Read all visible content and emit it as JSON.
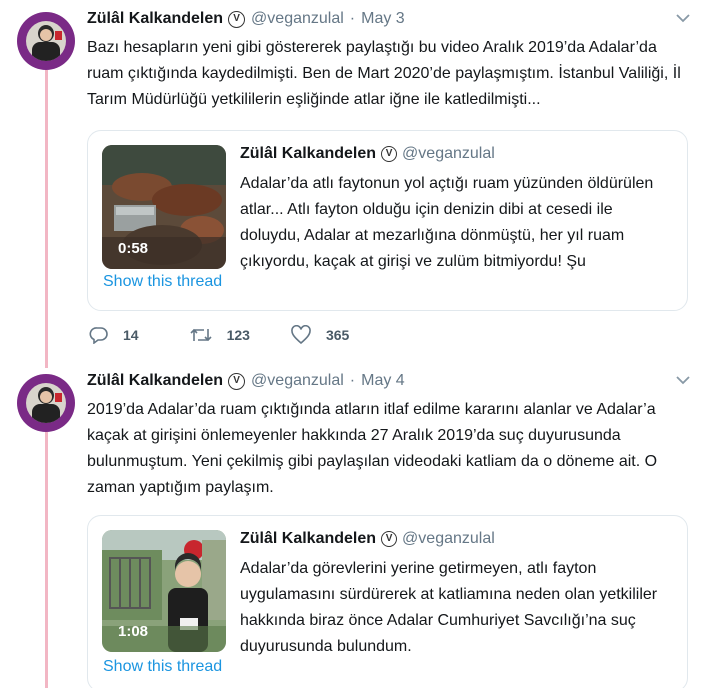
{
  "tweets": [
    {
      "author_name": "Zülâl Kalkandelen",
      "verified_glyph": "V",
      "handle": "@veganzulal",
      "separator": "·",
      "date": "May 3",
      "text": "Bazı hesapların yeni gibi göstererek paylaştığı bu video Aralık 2019’da Adalar’da ruam çıktığında kaydedilmişti. Ben de Mart 2020’de paylaşmıştım. İstanbul Valiliği, İl Tarım Müdürlüğü yetkililerin eşliğinde atlar iğne ile katledilmişti...",
      "quote": {
        "author_name": "Zülâl Kalkandelen",
        "verified_glyph": "V",
        "handle": "@veganzulal",
        "text": "Adalar’da atlı faytonun yol açtığı ruam yüzünden öldürülen atlar... Atlı fayton olduğu için denizin dibi at cesedi ile doluydu, Adalar at mezarlığına dönmüştü, her yıl ruam çıkıyordu, kaçak at girişi ve zulüm bitmiyordu! Şu",
        "video_duration": "0:58",
        "show_thread": "Show this thread"
      },
      "actions": {
        "replies": "14",
        "retweets": "123",
        "likes": "365"
      }
    },
    {
      "author_name": "Zülâl Kalkandelen",
      "verified_glyph": "V",
      "handle": "@veganzulal",
      "separator": "·",
      "date": "May 4",
      "text": "2019’da Adalar’da ruam çıktığında atların itlaf edilme kararını alanlar ve Adalar’a kaçak at girişini önlemeyenler hakkında 27 Aralık 2019’da suç duyurusunda bulunmuştum. Yeni çekilmiş gibi paylaşılan videodaki katliam da o döneme ait. O zaman yaptığım paylaşım.",
      "quote": {
        "author_name": "Zülâl Kalkandelen",
        "verified_glyph": "V",
        "handle": "@veganzulal",
        "text": "Adalar’da görevlerini yerine getirmeyen, atlı fayton uygulamasını sürdürerek at katliamına neden olan yetkililer hakkında biraz önce Adalar Cumhuriyet Savcılığı’na suç duyurusunda bulundum.",
        "video_duration": "1:08",
        "show_thread": "Show this thread"
      }
    }
  ],
  "icons": {
    "reply": "reply-icon",
    "retweet": "retweet-icon",
    "like": "heart-icon",
    "menu": "chevron-down-icon",
    "verified": "verified-icon"
  },
  "colors": {
    "thread_line": "#f2b6c4",
    "link": "#1b95e0",
    "muted": "#657786",
    "avatar_ring": "#7a2a86"
  }
}
